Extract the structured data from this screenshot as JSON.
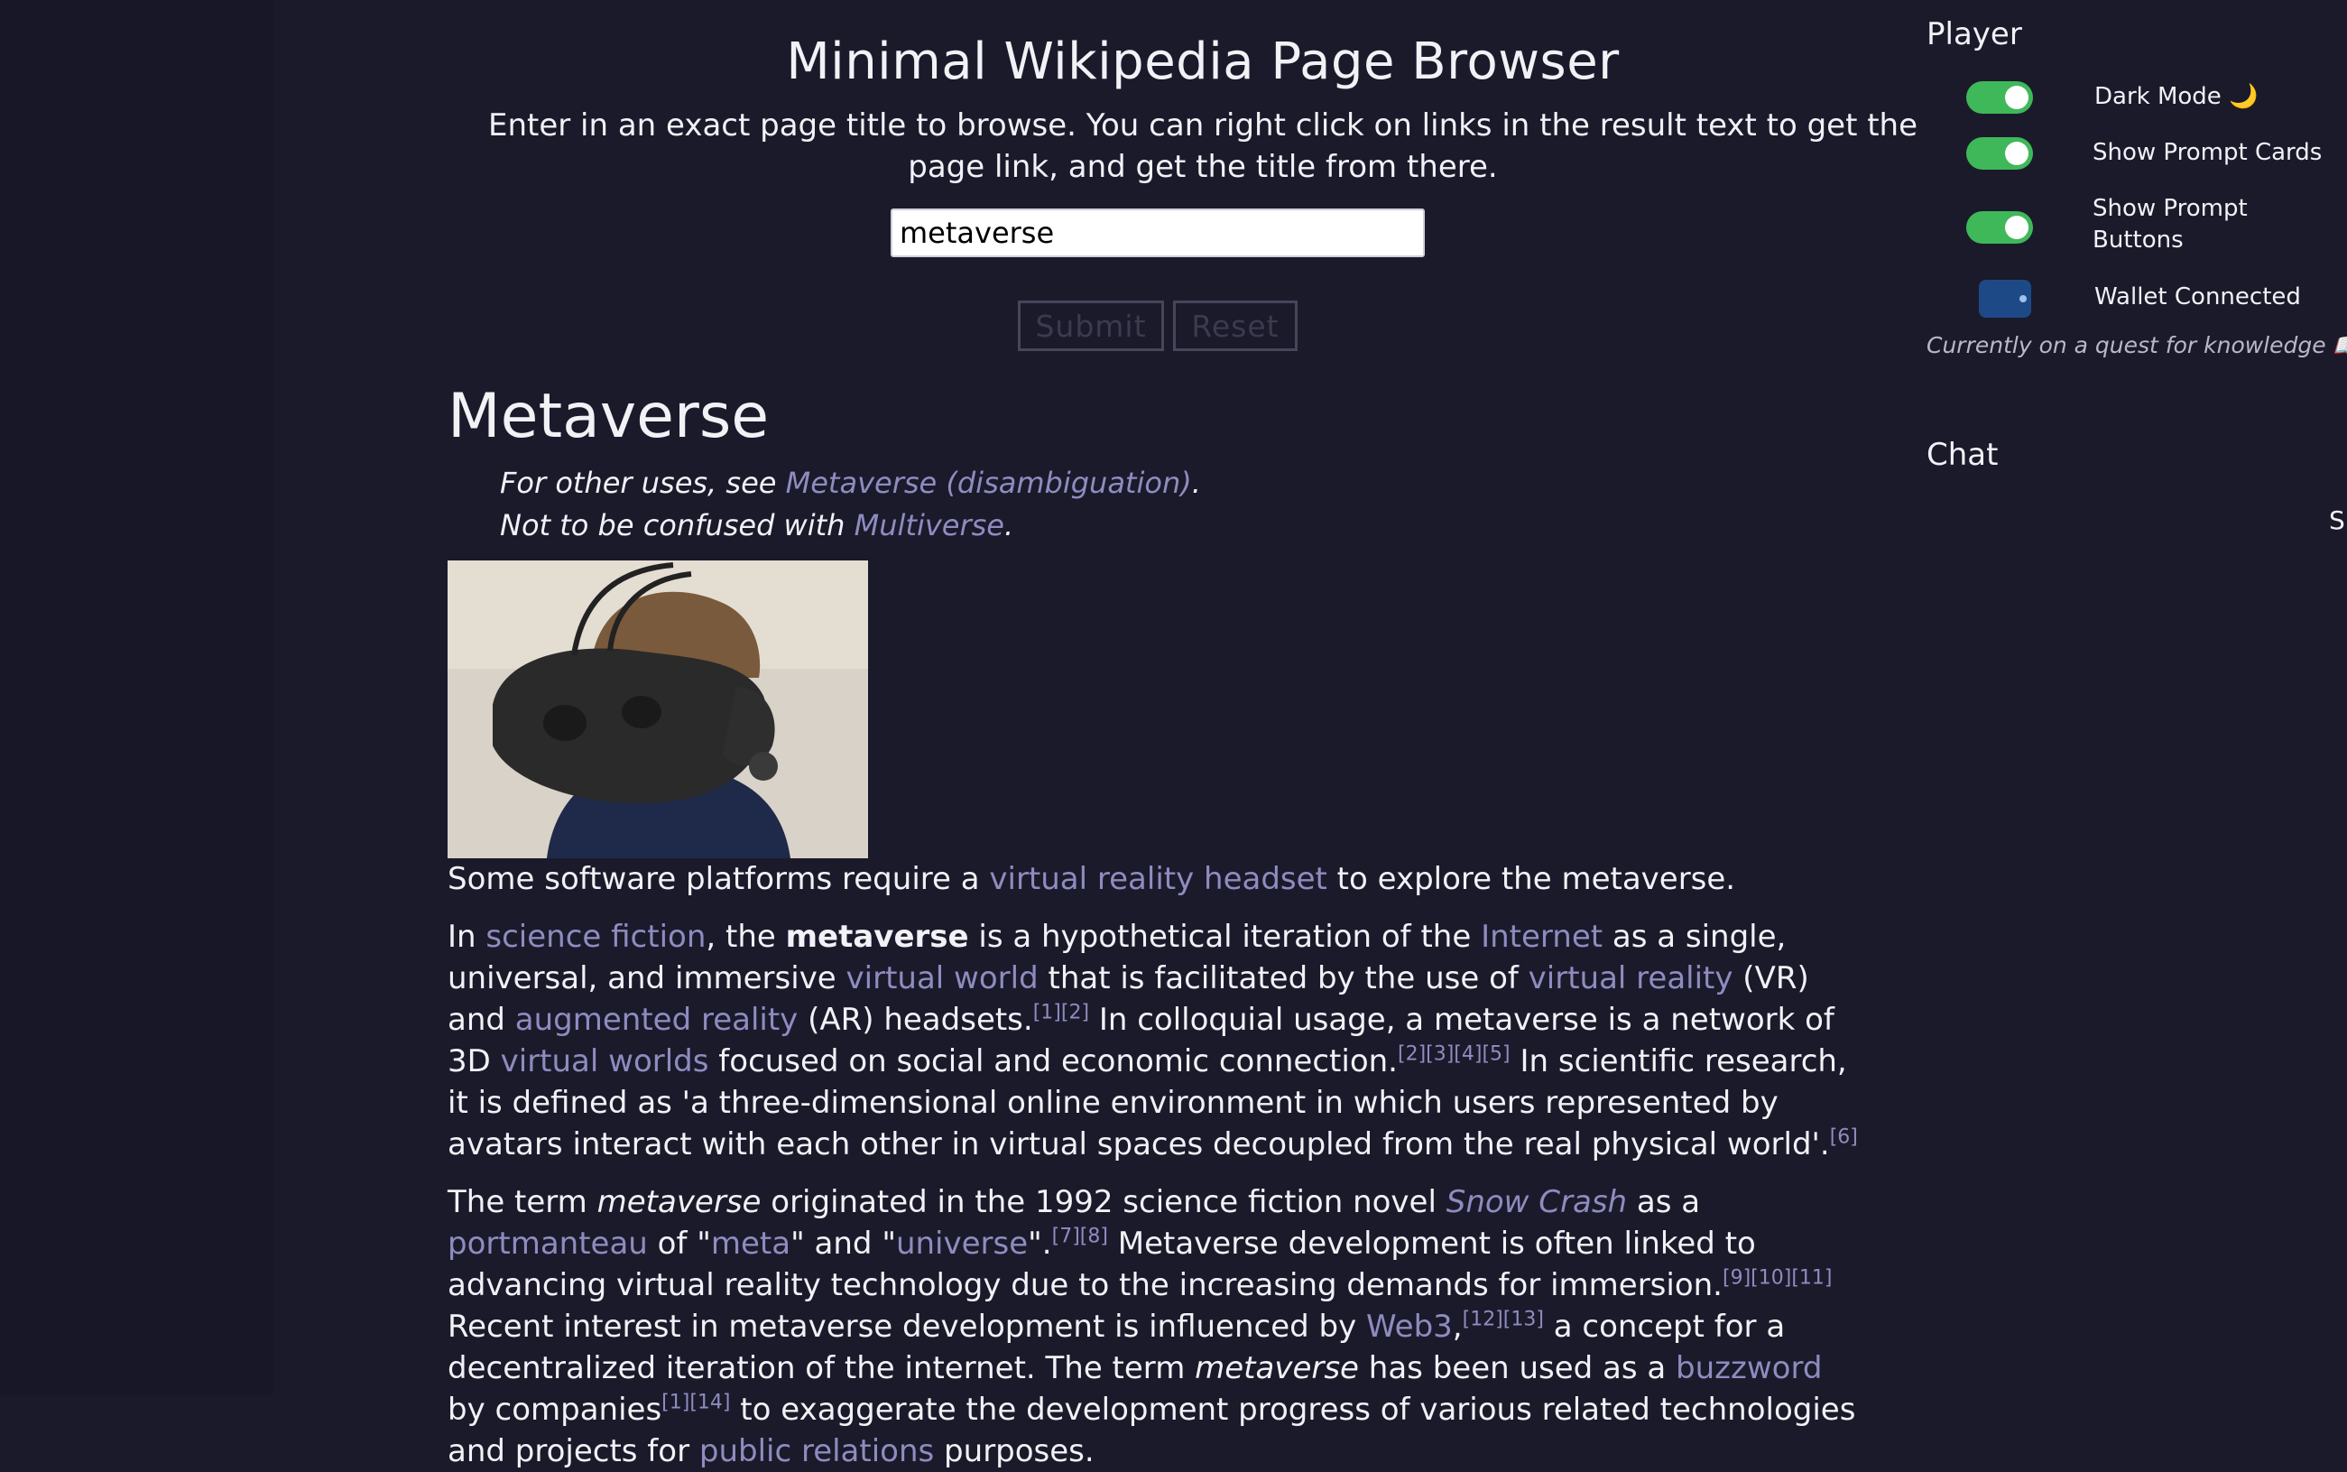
{
  "header": {
    "title": "Minimal Wikipedia Page Browser",
    "subtitle": "Enter in an exact page title to browse. You can right click on links in the result text to get the page link, and get the title from there."
  },
  "search": {
    "value": "metaverse",
    "placeholder": ""
  },
  "buttons": {
    "submit": "Submit",
    "reset": "Reset"
  },
  "article": {
    "title": "Metaverse",
    "hatnote1_prefix": "For other uses, see ",
    "hatnote1_link": "Metaverse (disambiguation)",
    "hatnote1_suffix": ".",
    "hatnote2_prefix": "Not to be confused with ",
    "hatnote2_link": "Multiverse",
    "hatnote2_suffix": ".",
    "caption": [
      {
        "t": "Some software platforms require a "
      },
      {
        "t": "virtual reality headset",
        "link": true
      },
      {
        "t": " to explore the metaverse."
      }
    ],
    "paragraphs": [
      [
        {
          "t": "In "
        },
        {
          "t": "science fiction",
          "link": true
        },
        {
          "t": ", the "
        },
        {
          "t": "metaverse",
          "bold": true
        },
        {
          "t": " is a hypothetical iteration of the "
        },
        {
          "t": "Internet",
          "link": true
        },
        {
          "t": " as a single, universal, and immersive "
        },
        {
          "t": "virtual world",
          "link": true
        },
        {
          "t": " that is facilitated by the use of "
        },
        {
          "t": "virtual reality",
          "link": true
        },
        {
          "t": " (VR) and "
        },
        {
          "t": "augmented reality",
          "link": true
        },
        {
          "t": " (AR) headsets."
        },
        {
          "t": "[1][2]",
          "sup": true
        },
        {
          "t": " In colloquial usage, a metaverse is a network of 3D "
        },
        {
          "t": "virtual worlds",
          "link": true
        },
        {
          "t": " focused on social and economic connection."
        },
        {
          "t": "[2][3][4][5]",
          "sup": true
        },
        {
          "t": " In scientific research, it is defined as 'a three-dimensional online environment in which users represented by avatars interact with each other in virtual spaces decoupled from the real physical world'."
        },
        {
          "t": "[6]",
          "sup": true
        }
      ],
      [
        {
          "t": "The term "
        },
        {
          "t": "metaverse",
          "italic": true
        },
        {
          "t": " originated in the 1992 science fiction novel "
        },
        {
          "t": "Snow Crash",
          "link": true,
          "italic": true
        },
        {
          "t": " as a "
        },
        {
          "t": "portmanteau",
          "link": true
        },
        {
          "t": " of \""
        },
        {
          "t": "meta",
          "link": true
        },
        {
          "t": "\" and \""
        },
        {
          "t": "universe",
          "link": true
        },
        {
          "t": "\"."
        },
        {
          "t": "[7][8]",
          "sup": true
        },
        {
          "t": " Metaverse development is often linked to advancing virtual reality technology due to the increasing demands for immersion."
        },
        {
          "t": "[9][10][11]",
          "sup": true
        },
        {
          "t": " Recent interest in metaverse development is influenced by "
        },
        {
          "t": "Web3",
          "link": true
        },
        {
          "t": ","
        },
        {
          "t": "[12][13]",
          "sup": true
        },
        {
          "t": " a concept for a decentralized iteration of the internet. The term "
        },
        {
          "t": "metaverse",
          "italic": true
        },
        {
          "t": " has been used as a "
        },
        {
          "t": "buzzword",
          "link": true
        },
        {
          "t": " by companies"
        },
        {
          "t": "[1][14]",
          "sup": true
        },
        {
          "t": " to exaggerate the development progress of various related technologies and projects for "
        },
        {
          "t": "public relations",
          "link": true
        },
        {
          "t": " purposes."
        }
      ]
    ]
  },
  "sidebar": {
    "player_title": "Player",
    "dark_mode": {
      "label": "Dark Mode 🌙",
      "on": true
    },
    "prompt_cards": {
      "label": "Show Prompt Cards",
      "on": true
    },
    "prompt_buttons": {
      "label": "Show Prompt Buttons",
      "on": true
    },
    "wallet": {
      "label": "Wallet Connected"
    },
    "status": "Currently on a quest for knowledge 📖",
    "chat_title": "Chat",
    "chat_partial": "S"
  },
  "colors": {
    "background": "#1b1a2b",
    "link": "#8e8cbf",
    "toggle_on": "#3fb85a",
    "wallet": "#1d4a86"
  }
}
